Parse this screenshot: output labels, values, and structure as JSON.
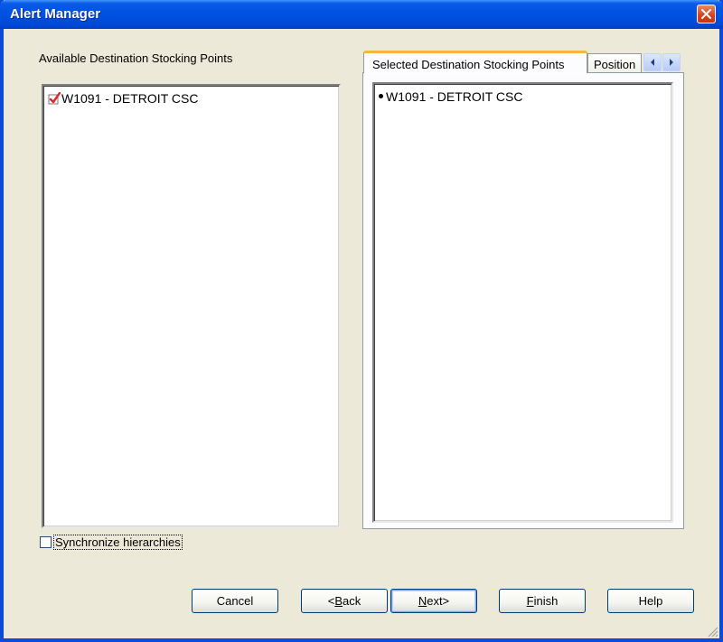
{
  "window": {
    "title": "Alert Manager"
  },
  "available": {
    "label": "Available Destination Stocking Points",
    "items": [
      {
        "label": "W1091 - DETROIT CSC",
        "checked": true
      }
    ]
  },
  "sync": {
    "label": "Synchronize hierarchies",
    "checked": false
  },
  "tabs": [
    {
      "label": "Selected Destination Stocking Points",
      "selected": true
    },
    {
      "label": "Position",
      "selected": false
    }
  ],
  "selected": {
    "items": [
      {
        "label": "W1091 - DETROIT CSC"
      }
    ]
  },
  "buttons": {
    "cancel": "Cancel",
    "back_prefix": "<",
    "back_accel": "B",
    "back_rest": "ack",
    "next_accel": "N",
    "next_rest": "ext>",
    "finish_accel": "F",
    "finish_rest": "inish",
    "help": "Help"
  },
  "colors": {
    "titlebar": "#0054e3",
    "face": "#ece9d8",
    "check_mark": "#e0262c",
    "tab_highlight": "#f5b63c"
  },
  "icons": {
    "close": "close-icon",
    "check": "checkmark-icon",
    "tab_left": "chevron-left-icon",
    "tab_right": "chevron-right-icon",
    "grip": "resize-grip-icon"
  }
}
